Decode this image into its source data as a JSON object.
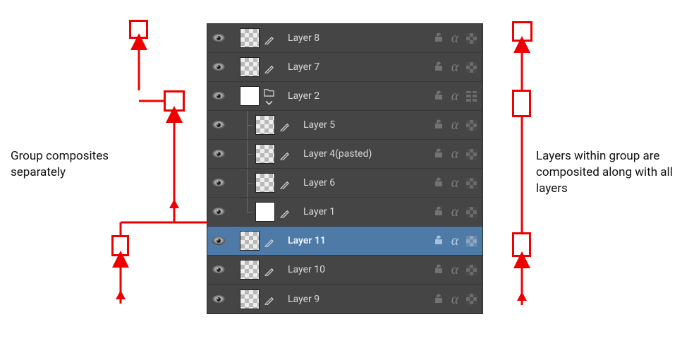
{
  "annotations": {
    "left": "Group composites separately",
    "right": "Layers within group are composited along with all layers"
  },
  "layers": [
    {
      "name": "Layer 8",
      "thumb": "checker",
      "indent": 0,
      "group": false,
      "selected": false
    },
    {
      "name": "Layer 7",
      "thumb": "checker",
      "indent": 0,
      "group": false,
      "selected": false
    },
    {
      "name": "Layer 2",
      "thumb": "white",
      "indent": 0,
      "group": true,
      "selected": false
    },
    {
      "name": "Layer 5",
      "thumb": "checker",
      "indent": 1,
      "group": false,
      "selected": false
    },
    {
      "name": "Layer 4(pasted)",
      "thumb": "checker",
      "indent": 1,
      "group": false,
      "selected": false
    },
    {
      "name": "Layer 6",
      "thumb": "checker",
      "indent": 1,
      "group": false,
      "selected": false
    },
    {
      "name": "Layer 1",
      "thumb": "white",
      "indent": 1,
      "group": false,
      "selected": false
    },
    {
      "name": "Layer 11",
      "thumb": "checker",
      "indent": 0,
      "group": false,
      "selected": true
    },
    {
      "name": "Layer 10",
      "thumb": "checker",
      "indent": 0,
      "group": false,
      "selected": false
    },
    {
      "name": "Layer 9",
      "thumb": "checker",
      "indent": 0,
      "group": false,
      "selected": false
    }
  ]
}
